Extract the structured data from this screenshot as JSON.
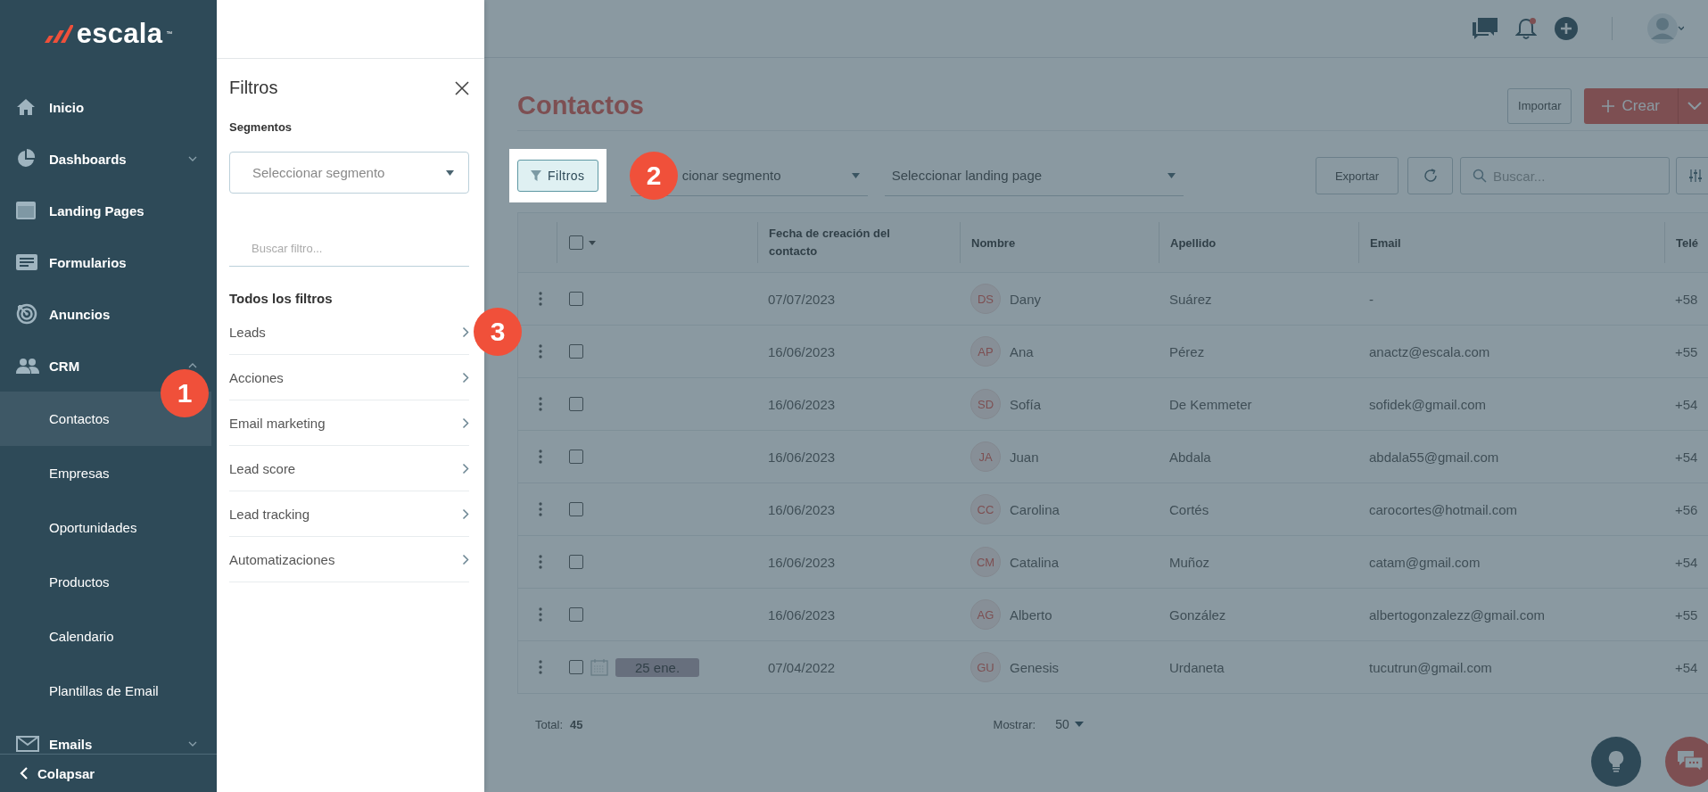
{
  "sidebar": {
    "logo": {
      "text": "escala",
      "mark": "™"
    },
    "items": [
      {
        "label": "Inicio",
        "kind": "link",
        "selected": false
      },
      {
        "label": "Dashboards",
        "kind": "group",
        "expanded": false,
        "selected": false
      },
      {
        "label": "Landing Pages",
        "kind": "link",
        "selected": false
      },
      {
        "label": "Formularios",
        "kind": "link",
        "selected": false
      },
      {
        "label": "Anuncios",
        "kind": "link",
        "selected": false
      },
      {
        "label": "CRM",
        "kind": "group",
        "expanded": true,
        "selected": false,
        "children": [
          {
            "label": "Contactos",
            "selected": true
          },
          {
            "label": "Empresas",
            "selected": false
          },
          {
            "label": "Oportunidades",
            "selected": false
          },
          {
            "label": "Productos",
            "selected": false
          },
          {
            "label": "Calendario",
            "selected": false
          },
          {
            "label": "Plantillas de Email",
            "selected": false
          }
        ]
      },
      {
        "label": "Emails",
        "kind": "group",
        "expanded": false,
        "selected": false
      }
    ],
    "collapse": "Colapsar"
  },
  "filter_panel": {
    "title": "Filtros",
    "segments_label": "Segmentos",
    "segment_select": {
      "placeholder": "Seleccionar segmento"
    },
    "search": {
      "placeholder": "Buscar filtro..."
    },
    "section_title": "Todos los filtros",
    "items": [
      "Leads",
      "Acciones",
      "Email marketing",
      "Lead score",
      "Lead tracking",
      "Automatizaciones"
    ]
  },
  "header": {
    "notifications_unread": true
  },
  "page": {
    "title": "Contactos",
    "import_button": "Importar",
    "create_button": "Crear"
  },
  "toolbar": {
    "filter_button": "Filtros",
    "segment_select": "cionar segmento",
    "landing_select": "Seleccionar landing page",
    "export_button": "Exportar",
    "search": {
      "placeholder": "Buscar..."
    }
  },
  "table": {
    "select_all_checked": false,
    "columns": [
      "Fecha de creación del contacto",
      "Nombre",
      "Apellido",
      "Email",
      "Telé"
    ],
    "rows": [
      {
        "checked": false,
        "date": "07/07/2023",
        "initials": "DS",
        "first_name": "Dany",
        "last_name": "Suárez",
        "email": "-",
        "phone": "+58"
      },
      {
        "checked": false,
        "date": "16/06/2023",
        "initials": "AP",
        "first_name": "Ana",
        "last_name": "Pérez",
        "email": "anactz@escala.com",
        "phone": "+55"
      },
      {
        "checked": false,
        "date": "16/06/2023",
        "initials": "SD",
        "first_name": "Sofía",
        "last_name": "De Kemmeter",
        "email": "sofidek@gmail.com",
        "phone": "+54"
      },
      {
        "checked": false,
        "date": "16/06/2023",
        "initials": "JA",
        "first_name": "Juan",
        "last_name": "Abdala",
        "email": "abdala55@gmail.com",
        "phone": "+54"
      },
      {
        "checked": false,
        "date": "16/06/2023",
        "initials": "CC",
        "first_name": "Carolina",
        "last_name": "Cortés",
        "email": "carocortes@hotmail.com",
        "phone": "+56"
      },
      {
        "checked": false,
        "date": "16/06/2023",
        "initials": "CM",
        "first_name": "Catalina",
        "last_name": "Muñoz",
        "email": "catam@gmail.com",
        "phone": "+54"
      },
      {
        "checked": false,
        "date": "16/06/2023",
        "initials": "AG",
        "first_name": "Alberto",
        "last_name": "González",
        "email": "albertogonzalezz@gmail.com",
        "phone": "+55"
      },
      {
        "checked": false,
        "date": "07/04/2022",
        "initials": "GU",
        "first_name": "Genesis",
        "last_name": "Urdaneta",
        "email": "tucutrun@gmail.com",
        "phone": "+54",
        "reminder": "25 ene."
      }
    ]
  },
  "footer": {
    "total_label": "Total:",
    "total": "45",
    "show_label": "Mostrar:",
    "page_size": "50"
  },
  "step_badges": [
    "1",
    "2",
    "3"
  ]
}
